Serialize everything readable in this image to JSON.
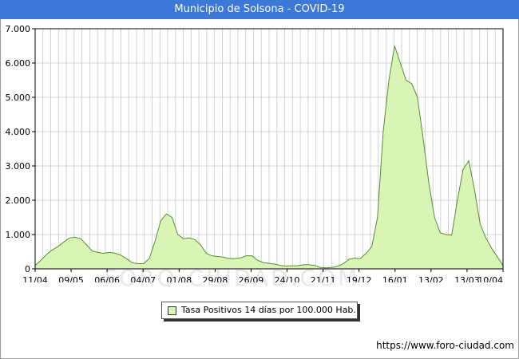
{
  "header": {
    "title": "Municipio de Solsona - COVID-19"
  },
  "footer": {
    "source": "https://www.foro-ciudad.com"
  },
  "watermark": "FORO-CIUDAD.COM",
  "colors": {
    "title_bg": "#3c78d8",
    "area_fill": "#d9f5b5",
    "area_line": "#5a8a3a",
    "grid": "#c8c8c8"
  },
  "chart_data": {
    "type": "area",
    "title": "Municipio de Solsona - COVID-19",
    "ylim": [
      0,
      7000
    ],
    "y_ticks": [
      0,
      1000,
      2000,
      3000,
      4000,
      5000,
      6000,
      7000
    ],
    "y_tick_labels": [
      "0",
      "1.000",
      "2.000",
      "3.000",
      "4.000",
      "5.000",
      "6.000",
      "7.000"
    ],
    "x_tick_labels": [
      "11/04",
      "09/05",
      "06/06",
      "04/07",
      "01/08",
      "29/08",
      "26/09",
      "24/10",
      "21/11",
      "19/12",
      "16/01",
      "13/02",
      "13/03",
      "10/04"
    ],
    "grid": true,
    "legend": {
      "position": "bottom-center",
      "label": "Tasa Positivos 14 días por 100.000 Hab."
    },
    "series": [
      {
        "name": "Tasa Positivos 14 días por 100.000 Hab.",
        "values": [
          100,
          250,
          420,
          550,
          650,
          780,
          900,
          920,
          880,
          700,
          520,
          480,
          450,
          480,
          460,
          400,
          300,
          180,
          150,
          150,
          300,
          800,
          1400,
          1600,
          1500,
          1000,
          880,
          900,
          850,
          700,
          450,
          380,
          360,
          340,
          300,
          300,
          320,
          380,
          380,
          250,
          180,
          160,
          140,
          100,
          80,
          90,
          90,
          120,
          120,
          100,
          40,
          30,
          40,
          80,
          150,
          280,
          310,
          300,
          450,
          650,
          1500,
          4000,
          5500,
          6500,
          6000,
          5500,
          5400,
          5000,
          3800,
          2500,
          1500,
          1050,
          1000,
          980,
          2000,
          2900,
          3150,
          2300,
          1300,
          900,
          600,
          350,
          100
        ]
      }
    ]
  }
}
